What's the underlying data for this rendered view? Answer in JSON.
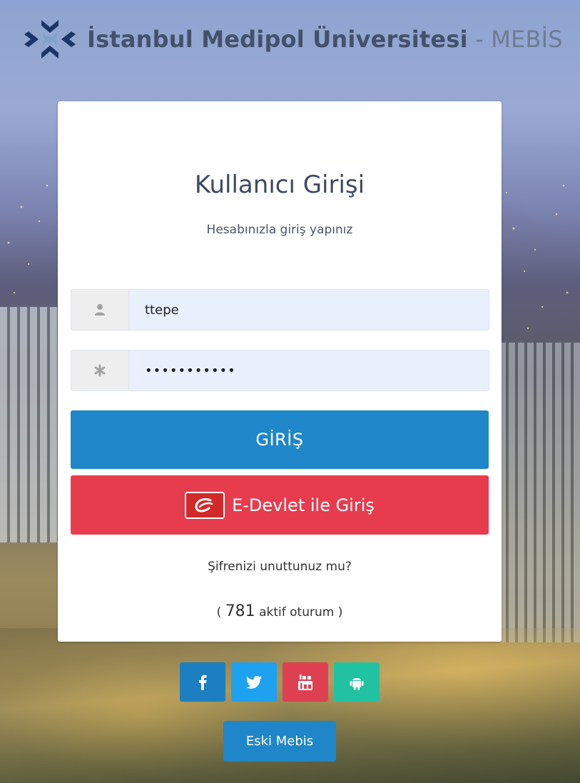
{
  "header": {
    "brand_name": "İstanbul Medipol Üniversitesi",
    "brand_separator": " - ",
    "brand_suffix": "MEBİS",
    "logo_icon": "medipol-chevrons-logo"
  },
  "login_card": {
    "title": "Kullanıcı Girişi",
    "subtitle": "Hesabınızla giriş yapınız",
    "username": {
      "value": "ttepe",
      "placeholder": "",
      "icon": "user-icon"
    },
    "password": {
      "value": "•••••••••••",
      "placeholder": "",
      "icon": "asterisk-icon"
    },
    "login_button_label": "GİRİŞ",
    "edevlet_button_label": "E-Devlet ile Giriş",
    "forgot_password_link": "Şifrenizi unuttunuz mu?",
    "sessions": {
      "open": "(",
      "count": "781",
      "label": "aktif oturum )"
    }
  },
  "social": {
    "items": [
      {
        "name": "facebook",
        "icon": "facebook-icon",
        "color": "#1c7fc1"
      },
      {
        "name": "twitter",
        "icon": "twitter-icon",
        "color": "#1ea1ef"
      },
      {
        "name": "youtube",
        "icon": "youtube-icon",
        "color": "#de4052"
      },
      {
        "name": "android",
        "icon": "android-icon",
        "color": "#21c2a2"
      }
    ]
  },
  "footer": {
    "old_mebis_label": "Eski Mebis"
  },
  "colors": {
    "primary": "#1f87c9",
    "danger": "#e73c4e",
    "title_text": "#3d4a5f"
  }
}
